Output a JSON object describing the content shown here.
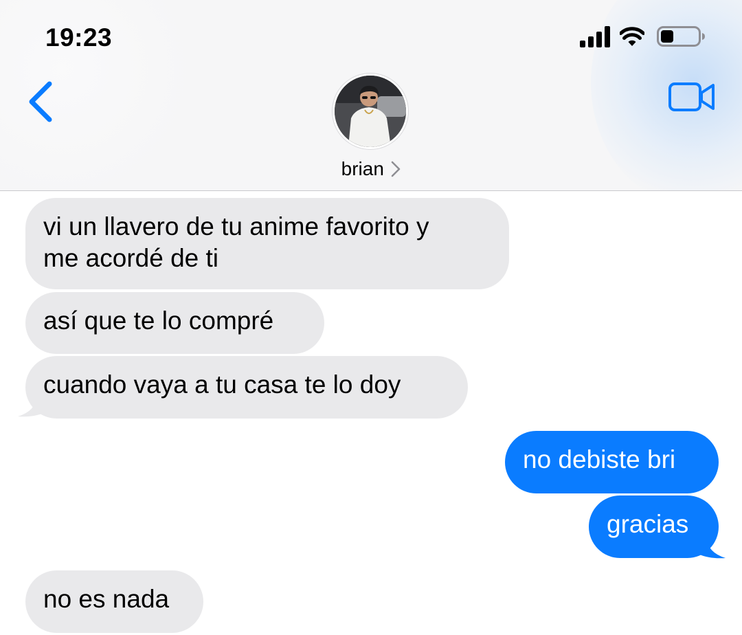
{
  "status_bar": {
    "time": "19:23",
    "icons": [
      "signal-bars-icon",
      "wifi-icon",
      "battery-icon"
    ],
    "battery_level": 0.35
  },
  "header": {
    "back_icon": "chevron-left-icon",
    "video_icon": "video-camera-icon",
    "contact_name": "brian",
    "contact_chevron": "chevron-right-icon",
    "accent_color": "#0a7cff"
  },
  "messages": [
    {
      "direction": "incoming",
      "lines": [
        "vi un llavero de tu anime favorito y",
        "me acordé de ti"
      ]
    },
    {
      "direction": "incoming",
      "text": "así que te lo compré"
    },
    {
      "direction": "incoming",
      "text": "cuando vaya a tu casa te lo doy"
    },
    {
      "direction": "outgoing",
      "text": "no debiste bri"
    },
    {
      "direction": "outgoing",
      "text": "gracias"
    },
    {
      "direction": "incoming",
      "text": "no es nada"
    }
  ],
  "colors": {
    "incoming_bubble": "#e9e9eb",
    "outgoing_bubble": "#0a7cff"
  }
}
